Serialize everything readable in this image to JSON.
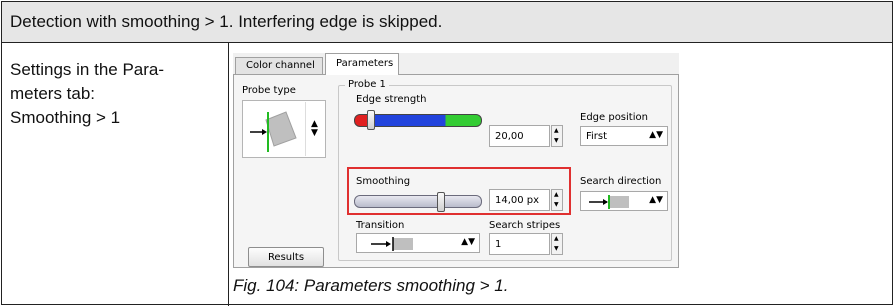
{
  "header": {
    "text": "Detection with smoothing > 1. Interfering edge is skipped."
  },
  "left_cell": {
    "line1": "Settings in the Para-",
    "line2": "meters tab:",
    "line3": "Smoothing > 1"
  },
  "caption": "Fig. 104: Parameters smoothing > 1.",
  "dialog": {
    "tabs": [
      "Color channel",
      "Parameters"
    ],
    "probe_type_label": "Probe type",
    "probe_group_label": "Probe 1",
    "edge_strength": {
      "label": "Edge strength",
      "value": "20,00",
      "level": 0.2
    },
    "smoothing": {
      "label": "Smoothing",
      "value": "14,00 px",
      "level": 0.65
    },
    "edge_position": {
      "label": "Edge position",
      "value": "First"
    },
    "search_direction": {
      "label": "Search direction"
    },
    "transition": {
      "label": "Transition"
    },
    "search_stripes": {
      "label": "Search stripes",
      "value": "1"
    },
    "results_button": "Results",
    "colors": {
      "highlight": "#e03030",
      "green": "#33cc33",
      "blue": "#2244dd",
      "red": "#e02020"
    }
  }
}
